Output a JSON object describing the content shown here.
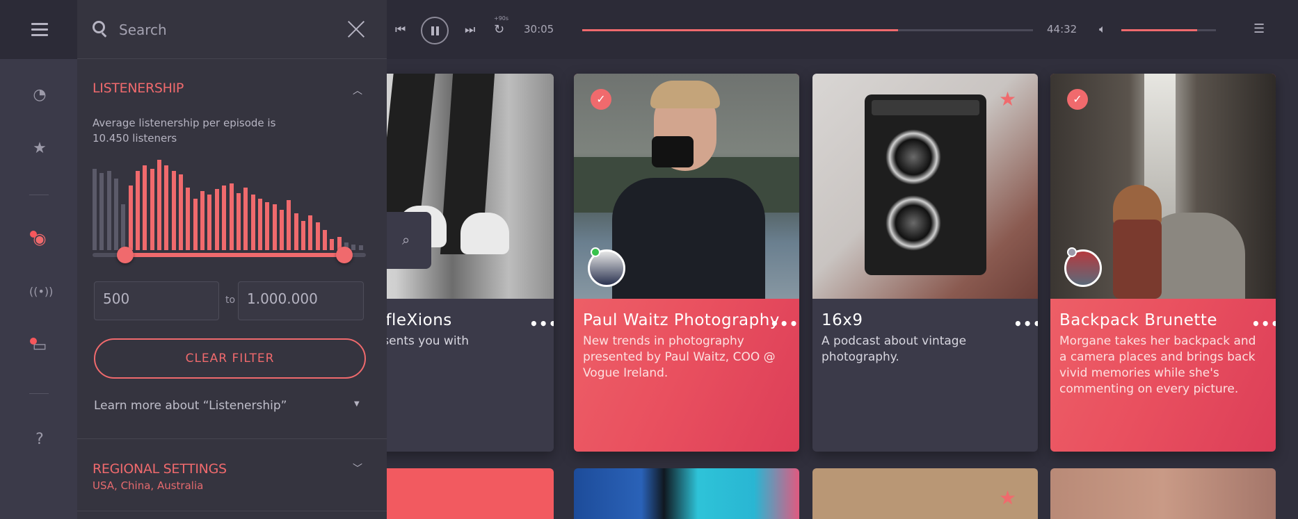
{
  "player": {
    "skip_label": "+90s",
    "elapsed": "30:05",
    "duration": "44:32",
    "progress": 0.7,
    "volume": 0.8
  },
  "search": {
    "placeholder": "Search"
  },
  "listenership": {
    "title": "Listenership",
    "description": "Average listenership per episode is 10.450 listeners",
    "min_value": "500",
    "to_label": "to",
    "max_value": "1.000.000",
    "clear_label": "CLEAR FILTER",
    "learn_more": "Learn more about “Listenership”",
    "histogram": [
      88,
      84,
      86,
      78,
      50,
      70,
      86,
      92,
      88,
      98,
      92,
      86,
      82,
      68,
      56,
      64,
      60,
      66,
      70,
      72,
      62,
      68,
      60,
      56,
      52,
      50,
      44,
      54,
      40,
      32,
      38,
      30,
      22,
      12,
      14,
      8,
      6,
      5
    ],
    "selected_range": [
      0.12,
      0.92
    ]
  },
  "regional": {
    "title": "Regional Settings",
    "subtitle": "USA, China, Australia"
  },
  "cards": [
    {
      "title": "ral RefleXions",
      "desc": "gan presents you with",
      "style": "dark"
    },
    {
      "title": "Paul Waitz Photography",
      "desc": "New trends in photography presented by Paul Waitz, COO @ Vogue Ireland.",
      "style": "red"
    },
    {
      "title": "16x9",
      "desc": "A podcast about vintage photography.",
      "style": "dark"
    },
    {
      "title": "Backpack Brunette",
      "desc": "Morgane takes her backpack and a camera places and brings back vivid memories while she's commenting on every picture.",
      "style": "red"
    }
  ],
  "colors": {
    "accent": "#f06a6d",
    "panel": "#35343f",
    "sidebar": "#3b3a49"
  }
}
